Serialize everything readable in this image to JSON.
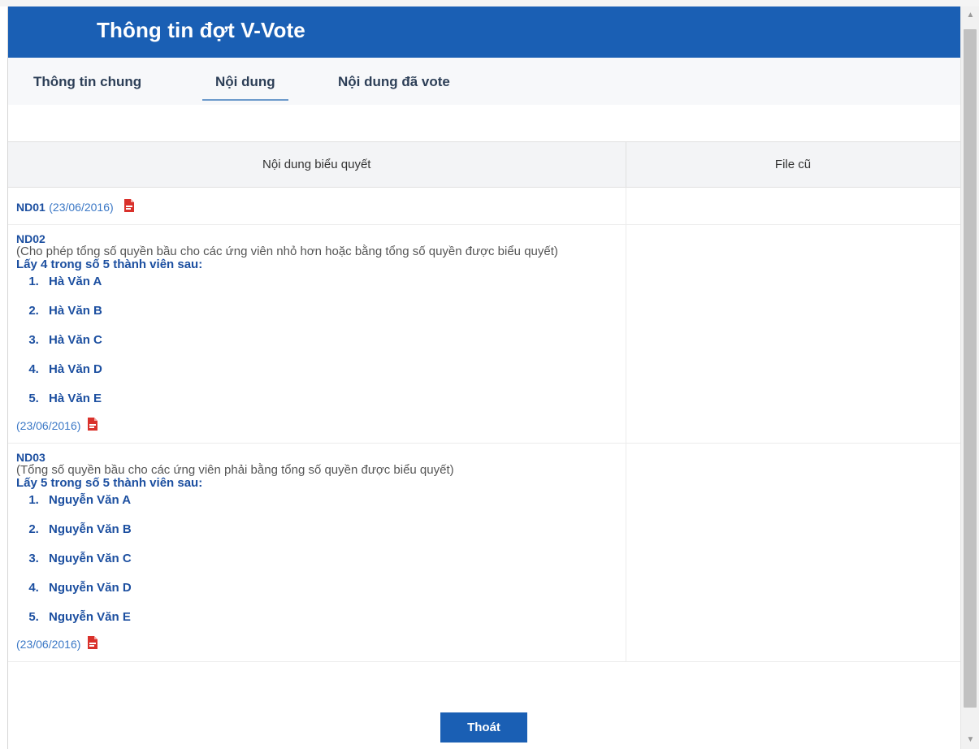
{
  "dialog": {
    "title": "Thông tin đợt V-Vote",
    "tabs": [
      {
        "label": "Thông tin chung"
      },
      {
        "label": "Nội dung"
      },
      {
        "label": "Nội dung đã vote"
      }
    ],
    "active_tab": "Nội dung"
  },
  "table": {
    "columns": [
      "Nội dung biểu quyết",
      "File cũ"
    ],
    "rows": [
      {
        "code": "ND01",
        "date": "(23/06/2016)",
        "description": "",
        "lead": "",
        "members": []
      },
      {
        "code": "ND02",
        "description": "(Cho phép tổng số quyền bầu cho các ứng viên nhỏ hơn hoặc bằng tổng số quyền được biểu quyết)",
        "lead": "Lấy 4 trong số 5 thành viên sau:",
        "members": [
          "Hà Văn A",
          "Hà Văn B",
          "Hà Văn C",
          "Hà Văn D",
          "Hà Văn E"
        ],
        "date": "(23/06/2016)"
      },
      {
        "code": "ND03",
        "description": "(Tổng số quyền bầu cho các ứng viên phải bằng tổng số quyền được biểu quyết)",
        "lead": "Lấy 5 trong số 5 thành viên sau:",
        "members": [
          "Nguyễn Văn A",
          "Nguyễn Văn B",
          "Nguyễn Văn C",
          "Nguyễn Văn D",
          "Nguyễn Văn E"
        ],
        "date": "(23/06/2016)"
      }
    ]
  },
  "footer": {
    "exit_label": "Thoát"
  },
  "icons": {
    "attachment": "pdf-file-icon"
  },
  "colors": {
    "header": "#1a5fb4",
    "link": "#1c4fa0",
    "date": "#3b78c6",
    "pdf": "#d9312b"
  }
}
